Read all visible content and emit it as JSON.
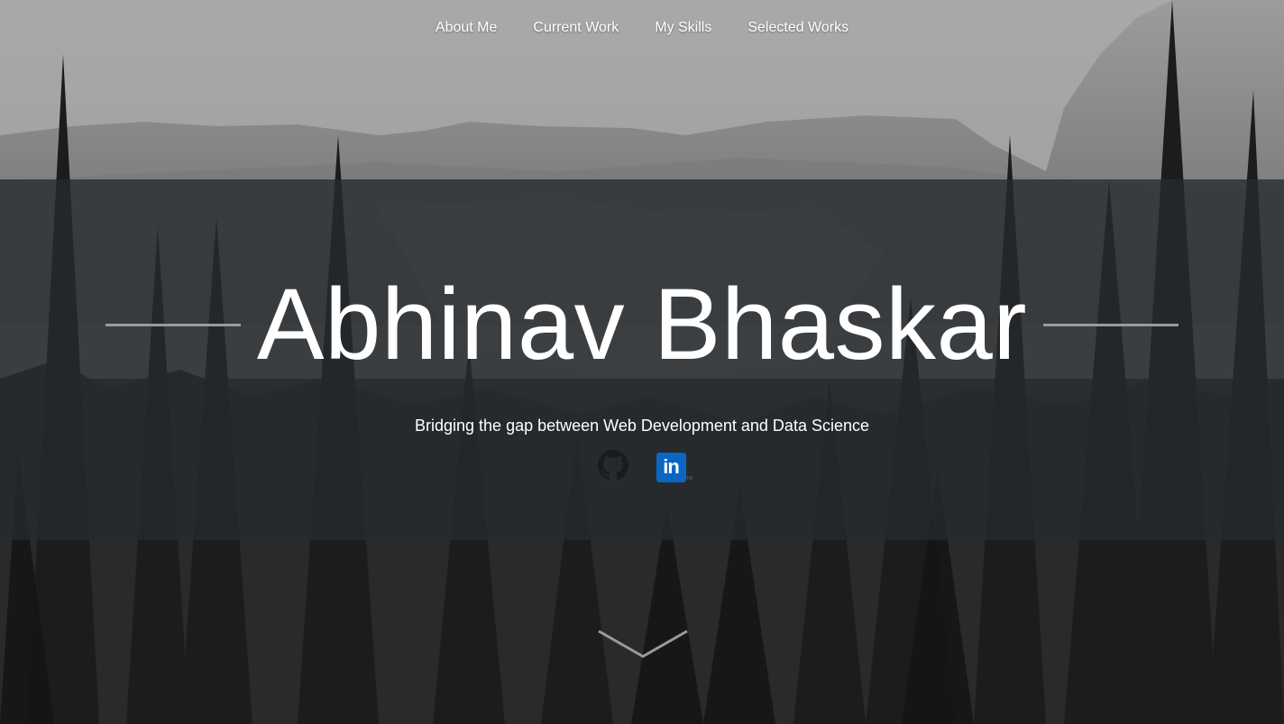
{
  "nav": {
    "items": [
      {
        "label": "About Me"
      },
      {
        "label": "Current Work"
      },
      {
        "label": "My Skills"
      },
      {
        "label": "Selected Works"
      }
    ]
  },
  "hero": {
    "title": "Abhinav Bhaskar",
    "tagline": "Bridging the gap between Web Development and Data Science"
  },
  "socials": {
    "github_icon": "github-icon",
    "linkedin_icon": "linkedin-icon",
    "linkedin_text": "in",
    "linkedin_tm": "TM"
  },
  "colors": {
    "band": "#262a2e",
    "linkedin": "#0a66c2",
    "rule": "#9a9a9a"
  }
}
